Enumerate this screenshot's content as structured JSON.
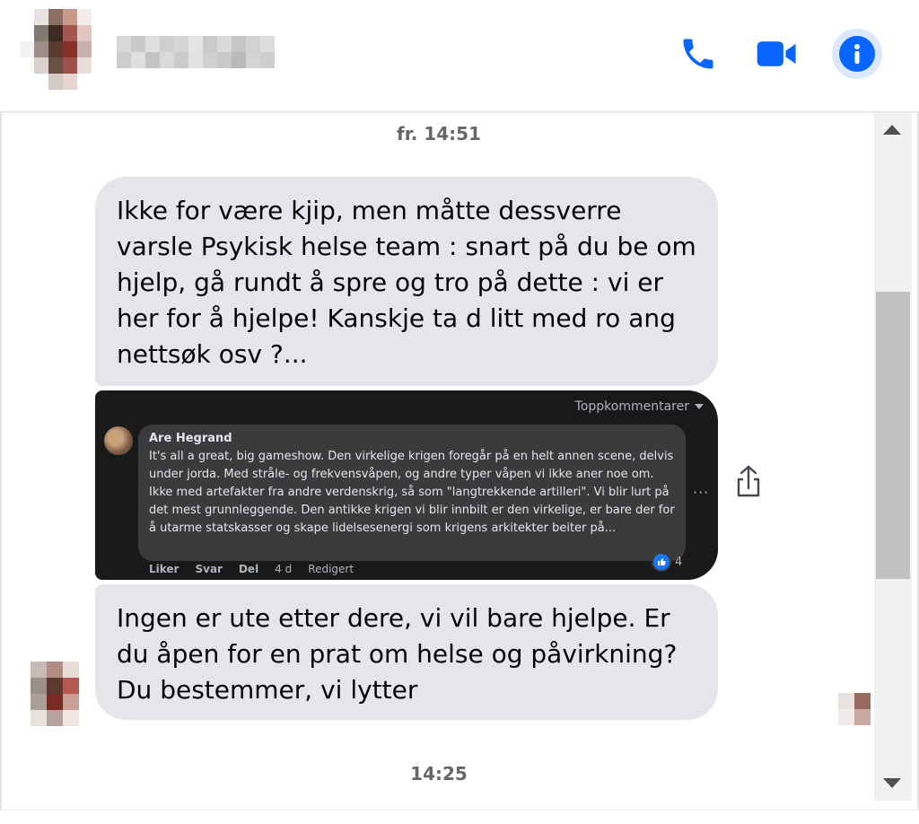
{
  "header": {
    "contact_name_blurred": true,
    "actions": {
      "call": "phone-icon",
      "video": "video-camera-icon",
      "info": "info-icon"
    },
    "accent": "#0866ff"
  },
  "conversation": {
    "timestamp_top": "fr. 14:51",
    "message1": "Ikke for være kjip, men måtte dessverre varsle Psykisk helse team : snart på du be om hjelp, gå rundt å spre og tro på dette :  vi er her for å hjelpe!   Kanskje ta d litt med ro ang nettsøk osv ?...",
    "embedded": {
      "sort_label": "Toppkommentarer",
      "author": "Are Hegrand",
      "comment": "It's all a great, big gameshow. Den virkelige krigen foregår på en helt annen scene, delvis under jorda. Med stråle- og frekvensvåpen, og andre typer våpen vi ikke aner noe om. Ikke med artefakter fra andre verdenskrig, så som \"langtrekkende artilleri\". Vi blir lurt på det mest grunnleggende. Den antikke krigen vi blir innbilt er den virkelige, er bare der for å utarme statskasser og skape lidelsesenergi som krigens arkitekter beiter på...",
      "actions": {
        "like": "Liker",
        "reply": "Svar",
        "share": "Del",
        "age": "4 d",
        "edited": "Redigert"
      },
      "reaction_count": "4"
    },
    "message2": "Ingen er ute etter dere, vi vil bare hjelpe.  Er du åpen for en prat om helse og påvirkning? Du bestemmer, vi lytter",
    "timestamp_bottom": "14:25"
  }
}
